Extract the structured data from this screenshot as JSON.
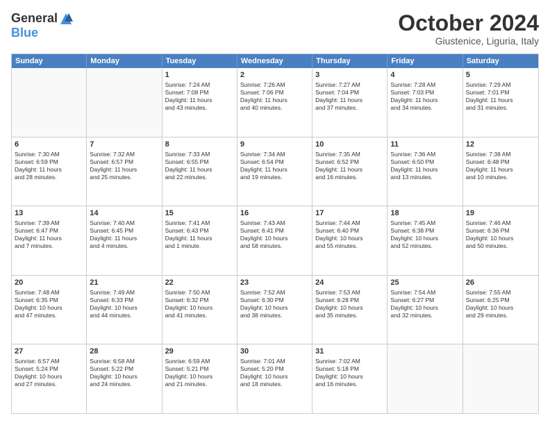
{
  "logo": {
    "general": "General",
    "blue": "Blue"
  },
  "header": {
    "month": "October 2024",
    "location": "Giustenice, Liguria, Italy"
  },
  "weekdays": [
    "Sunday",
    "Monday",
    "Tuesday",
    "Wednesday",
    "Thursday",
    "Friday",
    "Saturday"
  ],
  "rows": [
    [
      {
        "day": "",
        "empty": true
      },
      {
        "day": "",
        "empty": true
      },
      {
        "day": "1",
        "lines": [
          "Sunrise: 7:24 AM",
          "Sunset: 7:08 PM",
          "Daylight: 11 hours",
          "and 43 minutes."
        ]
      },
      {
        "day": "2",
        "lines": [
          "Sunrise: 7:26 AM",
          "Sunset: 7:06 PM",
          "Daylight: 11 hours",
          "and 40 minutes."
        ]
      },
      {
        "day": "3",
        "lines": [
          "Sunrise: 7:27 AM",
          "Sunset: 7:04 PM",
          "Daylight: 11 hours",
          "and 37 minutes."
        ]
      },
      {
        "day": "4",
        "lines": [
          "Sunrise: 7:28 AM",
          "Sunset: 7:03 PM",
          "Daylight: 11 hours",
          "and 34 minutes."
        ]
      },
      {
        "day": "5",
        "lines": [
          "Sunrise: 7:29 AM",
          "Sunset: 7:01 PM",
          "Daylight: 11 hours",
          "and 31 minutes."
        ]
      }
    ],
    [
      {
        "day": "6",
        "lines": [
          "Sunrise: 7:30 AM",
          "Sunset: 6:59 PM",
          "Daylight: 11 hours",
          "and 28 minutes."
        ]
      },
      {
        "day": "7",
        "lines": [
          "Sunrise: 7:32 AM",
          "Sunset: 6:57 PM",
          "Daylight: 11 hours",
          "and 25 minutes."
        ]
      },
      {
        "day": "8",
        "lines": [
          "Sunrise: 7:33 AM",
          "Sunset: 6:55 PM",
          "Daylight: 11 hours",
          "and 22 minutes."
        ]
      },
      {
        "day": "9",
        "lines": [
          "Sunrise: 7:34 AM",
          "Sunset: 6:54 PM",
          "Daylight: 11 hours",
          "and 19 minutes."
        ]
      },
      {
        "day": "10",
        "lines": [
          "Sunrise: 7:35 AM",
          "Sunset: 6:52 PM",
          "Daylight: 11 hours",
          "and 16 minutes."
        ]
      },
      {
        "day": "11",
        "lines": [
          "Sunrise: 7:36 AM",
          "Sunset: 6:50 PM",
          "Daylight: 11 hours",
          "and 13 minutes."
        ]
      },
      {
        "day": "12",
        "lines": [
          "Sunrise: 7:38 AM",
          "Sunset: 6:48 PM",
          "Daylight: 11 hours",
          "and 10 minutes."
        ]
      }
    ],
    [
      {
        "day": "13",
        "lines": [
          "Sunrise: 7:39 AM",
          "Sunset: 6:47 PM",
          "Daylight: 11 hours",
          "and 7 minutes."
        ]
      },
      {
        "day": "14",
        "lines": [
          "Sunrise: 7:40 AM",
          "Sunset: 6:45 PM",
          "Daylight: 11 hours",
          "and 4 minutes."
        ]
      },
      {
        "day": "15",
        "lines": [
          "Sunrise: 7:41 AM",
          "Sunset: 6:43 PM",
          "Daylight: 11 hours",
          "and 1 minute."
        ]
      },
      {
        "day": "16",
        "lines": [
          "Sunrise: 7:43 AM",
          "Sunset: 6:41 PM",
          "Daylight: 10 hours",
          "and 58 minutes."
        ]
      },
      {
        "day": "17",
        "lines": [
          "Sunrise: 7:44 AM",
          "Sunset: 6:40 PM",
          "Daylight: 10 hours",
          "and 55 minutes."
        ]
      },
      {
        "day": "18",
        "lines": [
          "Sunrise: 7:45 AM",
          "Sunset: 6:38 PM",
          "Daylight: 10 hours",
          "and 52 minutes."
        ]
      },
      {
        "day": "19",
        "lines": [
          "Sunrise: 7:46 AM",
          "Sunset: 6:36 PM",
          "Daylight: 10 hours",
          "and 50 minutes."
        ]
      }
    ],
    [
      {
        "day": "20",
        "lines": [
          "Sunrise: 7:48 AM",
          "Sunset: 6:35 PM",
          "Daylight: 10 hours",
          "and 47 minutes."
        ]
      },
      {
        "day": "21",
        "lines": [
          "Sunrise: 7:49 AM",
          "Sunset: 6:33 PM",
          "Daylight: 10 hours",
          "and 44 minutes."
        ]
      },
      {
        "day": "22",
        "lines": [
          "Sunrise: 7:50 AM",
          "Sunset: 6:32 PM",
          "Daylight: 10 hours",
          "and 41 minutes."
        ]
      },
      {
        "day": "23",
        "lines": [
          "Sunrise: 7:52 AM",
          "Sunset: 6:30 PM",
          "Daylight: 10 hours",
          "and 38 minutes."
        ]
      },
      {
        "day": "24",
        "lines": [
          "Sunrise: 7:53 AM",
          "Sunset: 6:28 PM",
          "Daylight: 10 hours",
          "and 35 minutes."
        ]
      },
      {
        "day": "25",
        "lines": [
          "Sunrise: 7:54 AM",
          "Sunset: 6:27 PM",
          "Daylight: 10 hours",
          "and 32 minutes."
        ]
      },
      {
        "day": "26",
        "lines": [
          "Sunrise: 7:55 AM",
          "Sunset: 6:25 PM",
          "Daylight: 10 hours",
          "and 29 minutes."
        ]
      }
    ],
    [
      {
        "day": "27",
        "lines": [
          "Sunrise: 6:57 AM",
          "Sunset: 5:24 PM",
          "Daylight: 10 hours",
          "and 27 minutes."
        ]
      },
      {
        "day": "28",
        "lines": [
          "Sunrise: 6:58 AM",
          "Sunset: 5:22 PM",
          "Daylight: 10 hours",
          "and 24 minutes."
        ]
      },
      {
        "day": "29",
        "lines": [
          "Sunrise: 6:59 AM",
          "Sunset: 5:21 PM",
          "Daylight: 10 hours",
          "and 21 minutes."
        ]
      },
      {
        "day": "30",
        "lines": [
          "Sunrise: 7:01 AM",
          "Sunset: 5:20 PM",
          "Daylight: 10 hours",
          "and 18 minutes."
        ]
      },
      {
        "day": "31",
        "lines": [
          "Sunrise: 7:02 AM",
          "Sunset: 5:18 PM",
          "Daylight: 10 hours",
          "and 16 minutes."
        ]
      },
      {
        "day": "",
        "empty": true
      },
      {
        "day": "",
        "empty": true
      }
    ]
  ]
}
